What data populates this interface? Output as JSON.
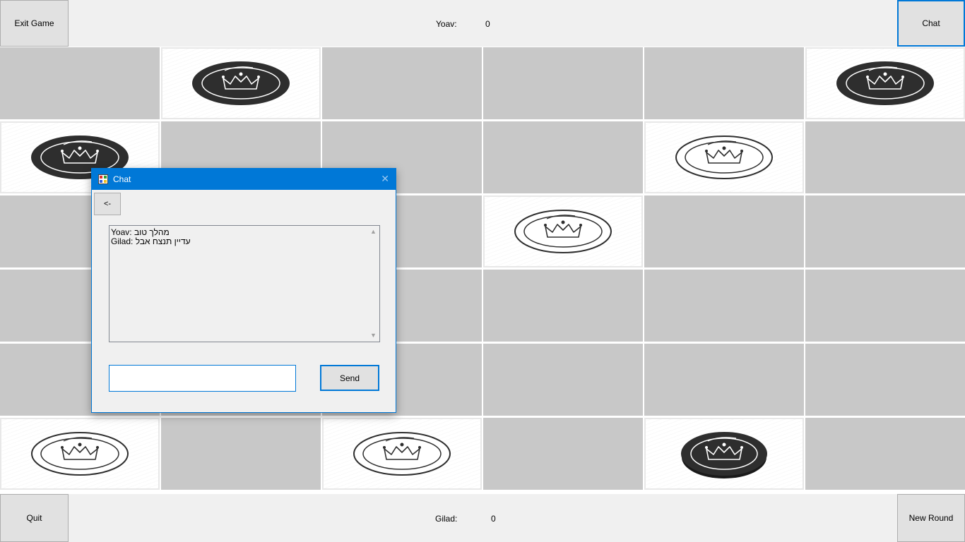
{
  "top_bar": {
    "exit_button": "Exit Game",
    "player1_name": "Yoav:",
    "player1_score": "0",
    "chat_button": "Chat"
  },
  "bottom_bar": {
    "quit_button": "Quit",
    "player2_name": "Gilad:",
    "player2_score": "0",
    "new_round_button": "New Round"
  },
  "board": {
    "cells": [
      {
        "row": 0,
        "col": 0,
        "state": "hidden"
      },
      {
        "row": 0,
        "col": 1,
        "state": "card",
        "coin": "dark-coin-crown-icon"
      },
      {
        "row": 0,
        "col": 2,
        "state": "hidden"
      },
      {
        "row": 0,
        "col": 3,
        "state": "hidden"
      },
      {
        "row": 0,
        "col": 4,
        "state": "hidden"
      },
      {
        "row": 0,
        "col": 5,
        "state": "card",
        "coin": "dark-coin-crown-icon"
      },
      {
        "row": 1,
        "col": 0,
        "state": "card",
        "coin": "dark-coin-crown-icon"
      },
      {
        "row": 1,
        "col": 1,
        "state": "hidden"
      },
      {
        "row": 1,
        "col": 2,
        "state": "hidden"
      },
      {
        "row": 1,
        "col": 3,
        "state": "hidden"
      },
      {
        "row": 1,
        "col": 4,
        "state": "card",
        "coin": "light-coin-crown-icon"
      },
      {
        "row": 1,
        "col": 5,
        "state": "hidden"
      },
      {
        "row": 2,
        "col": 0,
        "state": "hidden"
      },
      {
        "row": 2,
        "col": 1,
        "state": "hidden"
      },
      {
        "row": 2,
        "col": 2,
        "state": "hidden"
      },
      {
        "row": 2,
        "col": 3,
        "state": "card",
        "coin": "light-coin-crown-icon"
      },
      {
        "row": 2,
        "col": 4,
        "state": "hidden"
      },
      {
        "row": 2,
        "col": 5,
        "state": "hidden"
      },
      {
        "row": 3,
        "col": 0,
        "state": "hidden"
      },
      {
        "row": 3,
        "col": 1,
        "state": "hidden"
      },
      {
        "row": 3,
        "col": 2,
        "state": "hidden"
      },
      {
        "row": 3,
        "col": 3,
        "state": "hidden"
      },
      {
        "row": 3,
        "col": 4,
        "state": "hidden"
      },
      {
        "row": 3,
        "col": 5,
        "state": "hidden"
      },
      {
        "row": 4,
        "col": 0,
        "state": "hidden"
      },
      {
        "row": 4,
        "col": 1,
        "state": "hidden"
      },
      {
        "row": 4,
        "col": 2,
        "state": "hidden"
      },
      {
        "row": 4,
        "col": 3,
        "state": "hidden"
      },
      {
        "row": 4,
        "col": 4,
        "state": "hidden"
      },
      {
        "row": 4,
        "col": 5,
        "state": "hidden"
      },
      {
        "row": 5,
        "col": 0,
        "state": "card",
        "coin": "light-coin-crown-icon"
      },
      {
        "row": 5,
        "col": 1,
        "state": "hidden"
      },
      {
        "row": 5,
        "col": 2,
        "state": "card",
        "coin": "light-coin-crown-icon"
      },
      {
        "row": 5,
        "col": 3,
        "state": "hidden"
      },
      {
        "row": 5,
        "col": 4,
        "state": "card",
        "coin": "dark-coin-crown-tilted-icon"
      },
      {
        "row": 5,
        "col": 5,
        "state": "hidden"
      }
    ]
  },
  "chat": {
    "title": "Chat",
    "back_button": "<-",
    "messages": [
      {
        "sender": "Yoav:",
        "text": "מהלך טוב"
      },
      {
        "sender": "Gilad:",
        "text": "עדיין תנצח אבל"
      }
    ],
    "input_value": "",
    "send_button": "Send"
  },
  "colors": {
    "accent": "#0078d7",
    "hidden_cell": "#c8c8c8",
    "bar": "#f0f0f0"
  }
}
